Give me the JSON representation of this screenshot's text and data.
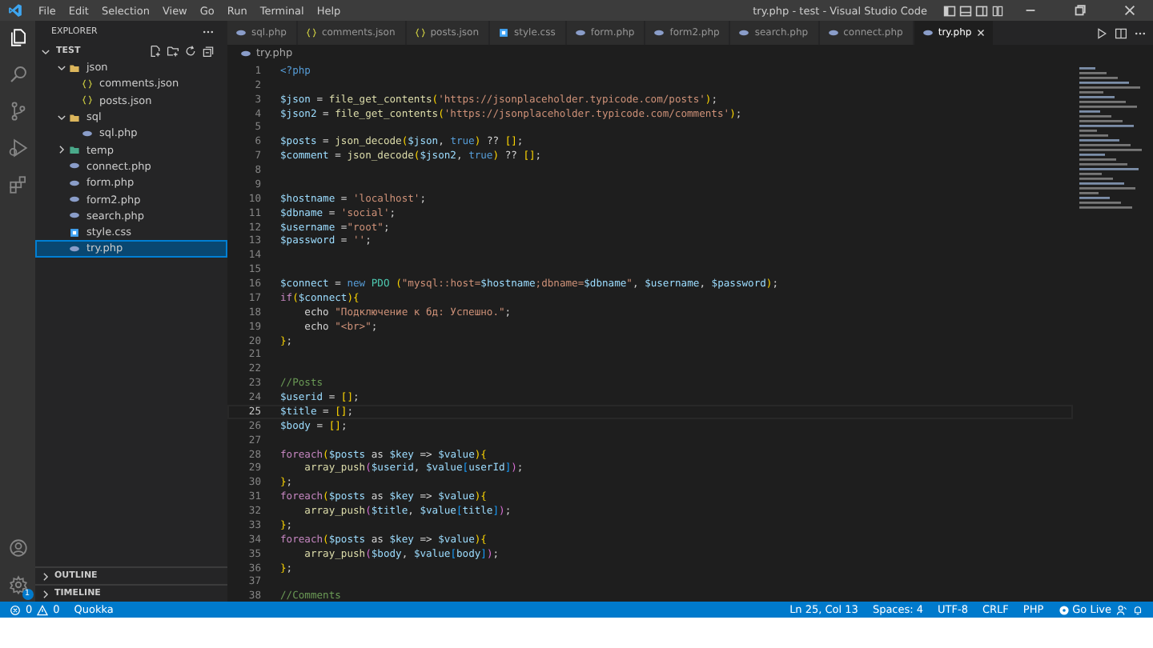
{
  "window": {
    "title": "try.php - test - Visual Studio Code"
  },
  "menu": [
    "File",
    "Edit",
    "Selection",
    "View",
    "Go",
    "Run",
    "Terminal",
    "Help"
  ],
  "activity_bar": {
    "badge": "1"
  },
  "explorer": {
    "title": "EXPLORER",
    "root": "TEST",
    "items": [
      {
        "label": "json",
        "kind": "folder",
        "expanded": true,
        "selected": false,
        "children": [
          {
            "label": "comments.json",
            "kind": "json",
            "selected": false
          },
          {
            "label": "posts.json",
            "kind": "json",
            "selected": false
          }
        ]
      },
      {
        "label": "sql",
        "kind": "folder",
        "expanded": true,
        "selected": false,
        "children": [
          {
            "label": "sql.php",
            "kind": "php",
            "selected": false
          }
        ]
      },
      {
        "label": "temp",
        "kind": "folder",
        "expanded": false,
        "selected": false
      },
      {
        "label": "connect.php",
        "kind": "php",
        "selected": false
      },
      {
        "label": "form.php",
        "kind": "php",
        "selected": false
      },
      {
        "label": "form2.php",
        "kind": "php",
        "selected": false
      },
      {
        "label": "search.php",
        "kind": "php",
        "selected": false
      },
      {
        "label": "style.css",
        "kind": "css",
        "selected": false
      },
      {
        "label": "try.php",
        "kind": "php",
        "selected": true
      }
    ],
    "sections": [
      "OUTLINE",
      "TIMELINE"
    ]
  },
  "tabs": [
    {
      "label": "sql.php",
      "kind": "php",
      "selected": false
    },
    {
      "label": "comments.json",
      "kind": "json",
      "selected": false
    },
    {
      "label": "posts.json",
      "kind": "json",
      "selected": false
    },
    {
      "label": "style.css",
      "kind": "css",
      "selected": false
    },
    {
      "label": "form.php",
      "kind": "php",
      "selected": false
    },
    {
      "label": "form2.php",
      "kind": "php",
      "selected": false
    },
    {
      "label": "search.php",
      "kind": "php",
      "selected": false
    },
    {
      "label": "connect.php",
      "kind": "php",
      "selected": false
    },
    {
      "label": "try.php",
      "kind": "php",
      "selected": true
    }
  ],
  "breadcrumb": "try.php",
  "code": [
    {
      "n": "1",
      "current": false,
      "t": [
        {
          "kind": "tag",
          "text": "<?php"
        }
      ]
    },
    {
      "n": "2",
      "current": false
    },
    {
      "n": "3",
      "current": false,
      "t": [
        {
          "kind": "var",
          "text": "$json"
        },
        {
          "kind": "op",
          "text": " = "
        },
        {
          "kind": "fn",
          "text": "file_get_contents"
        },
        {
          "kind": "b1",
          "text": "("
        },
        {
          "kind": "str",
          "text": "'https://jsonplaceholder.typicode.com/posts'"
        },
        {
          "kind": "b1",
          "text": ")"
        },
        {
          "kind": "op",
          "text": ";"
        }
      ]
    },
    {
      "n": "4",
      "current": false,
      "t": [
        {
          "kind": "var",
          "text": "$json2"
        },
        {
          "kind": "op",
          "text": " = "
        },
        {
          "kind": "fn",
          "text": "file_get_contents"
        },
        {
          "kind": "b1",
          "text": "("
        },
        {
          "kind": "str",
          "text": "'https://jsonplaceholder.typicode.com/comments'"
        },
        {
          "kind": "b1",
          "text": ")"
        },
        {
          "kind": "op",
          "text": ";"
        }
      ]
    },
    {
      "n": "5",
      "current": false
    },
    {
      "n": "6",
      "current": false,
      "t": [
        {
          "kind": "var",
          "text": "$posts"
        },
        {
          "kind": "op",
          "text": " = "
        },
        {
          "kind": "fn",
          "text": "json_decode"
        },
        {
          "kind": "b1",
          "text": "("
        },
        {
          "kind": "var",
          "text": "$json"
        },
        {
          "kind": "op",
          "text": ", "
        },
        {
          "kind": "const",
          "text": "true"
        },
        {
          "kind": "b1",
          "text": ")"
        },
        {
          "kind": "op",
          "text": " ?? "
        },
        {
          "kind": "b1",
          "text": "[]"
        },
        {
          "kind": "op",
          "text": ";"
        }
      ]
    },
    {
      "n": "7",
      "current": false,
      "t": [
        {
          "kind": "var",
          "text": "$comment"
        },
        {
          "kind": "op",
          "text": " = "
        },
        {
          "kind": "fn",
          "text": "json_decode"
        },
        {
          "kind": "b1",
          "text": "("
        },
        {
          "kind": "var",
          "text": "$json2"
        },
        {
          "kind": "op",
          "text": ", "
        },
        {
          "kind": "const",
          "text": "true"
        },
        {
          "kind": "b1",
          "text": ")"
        },
        {
          "kind": "op",
          "text": " ?? "
        },
        {
          "kind": "b1",
          "text": "[]"
        },
        {
          "kind": "op",
          "text": ";"
        }
      ]
    },
    {
      "n": "8",
      "current": false
    },
    {
      "n": "9",
      "current": false
    },
    {
      "n": "10",
      "current": false,
      "t": [
        {
          "kind": "var",
          "text": "$hostname"
        },
        {
          "kind": "op",
          "text": " = "
        },
        {
          "kind": "str",
          "text": "'localhost'"
        },
        {
          "kind": "op",
          "text": ";"
        }
      ]
    },
    {
      "n": "11",
      "current": false,
      "t": [
        {
          "kind": "var",
          "text": "$dbname"
        },
        {
          "kind": "op",
          "text": " = "
        },
        {
          "kind": "str",
          "text": "'social'"
        },
        {
          "kind": "op",
          "text": ";"
        }
      ]
    },
    {
      "n": "12",
      "current": false,
      "t": [
        {
          "kind": "var",
          "text": "$username"
        },
        {
          "kind": "op",
          "text": " ="
        },
        {
          "kind": "str",
          "text": "\"root\""
        },
        {
          "kind": "op",
          "text": ";"
        }
      ]
    },
    {
      "n": "13",
      "current": false,
      "t": [
        {
          "kind": "var",
          "text": "$password"
        },
        {
          "kind": "op",
          "text": " = "
        },
        {
          "kind": "str",
          "text": "''"
        },
        {
          "kind": "op",
          "text": ";"
        }
      ]
    },
    {
      "n": "14",
      "current": false
    },
    {
      "n": "15",
      "current": false
    },
    {
      "n": "16",
      "current": false,
      "t": [
        {
          "kind": "var",
          "text": "$connect"
        },
        {
          "kind": "op",
          "text": " = "
        },
        {
          "kind": "const",
          "text": "new"
        },
        {
          "kind": "cls",
          "text": " PDO "
        },
        {
          "kind": "b1",
          "text": "("
        },
        {
          "kind": "str",
          "text": "\"mysql::host="
        },
        {
          "kind": "var",
          "text": "$hostname"
        },
        {
          "kind": "str",
          "text": ";dbname="
        },
        {
          "kind": "var",
          "text": "$dbname"
        },
        {
          "kind": "str",
          "text": "\""
        },
        {
          "kind": "op",
          "text": ", "
        },
        {
          "kind": "var",
          "text": "$username"
        },
        {
          "kind": "op",
          "text": ", "
        },
        {
          "kind": "var",
          "text": "$password"
        },
        {
          "kind": "b1",
          "text": ")"
        },
        {
          "kind": "op",
          "text": ";"
        }
      ]
    },
    {
      "n": "17",
      "current": false,
      "t": [
        {
          "kind": "kw",
          "text": "if"
        },
        {
          "kind": "b1",
          "text": "("
        },
        {
          "kind": "var",
          "text": "$connect"
        },
        {
          "kind": "b1",
          "text": "){"
        }
      ]
    },
    {
      "n": "18",
      "current": false,
      "t": [
        {
          "kind": "op",
          "text": "    echo "
        },
        {
          "kind": "str",
          "text": "\"Подключение к бд: Успешно.\""
        },
        {
          "kind": "op",
          "text": ";"
        }
      ]
    },
    {
      "n": "19",
      "current": false,
      "t": [
        {
          "kind": "op",
          "text": "    echo "
        },
        {
          "kind": "str",
          "text": "\"<br>\""
        },
        {
          "kind": "op",
          "text": ";"
        }
      ]
    },
    {
      "n": "20",
      "current": false,
      "t": [
        {
          "kind": "b1",
          "text": "}"
        },
        {
          "kind": "op",
          "text": ";"
        }
      ]
    },
    {
      "n": "21",
      "current": false
    },
    {
      "n": "22",
      "current": false
    },
    {
      "n": "23",
      "current": false,
      "t": [
        {
          "kind": "comment",
          "text": "//Posts"
        }
      ]
    },
    {
      "n": "24",
      "current": false,
      "t": [
        {
          "kind": "var",
          "text": "$userid"
        },
        {
          "kind": "op",
          "text": " = "
        },
        {
          "kind": "b1",
          "text": "[]"
        },
        {
          "kind": "op",
          "text": ";"
        }
      ]
    },
    {
      "n": "25",
      "current": true,
      "t": [
        {
          "kind": "var",
          "text": "$title"
        },
        {
          "kind": "op",
          "text": " = "
        },
        {
          "kind": "b1",
          "text": "[]"
        },
        {
          "kind": "op",
          "text": ";"
        }
      ]
    },
    {
      "n": "26",
      "current": false,
      "t": [
        {
          "kind": "var",
          "text": "$body"
        },
        {
          "kind": "op",
          "text": " = "
        },
        {
          "kind": "b1",
          "text": "[]"
        },
        {
          "kind": "op",
          "text": ";"
        }
      ]
    },
    {
      "n": "27",
      "current": false
    },
    {
      "n": "28",
      "current": false,
      "t": [
        {
          "kind": "kw",
          "text": "foreach"
        },
        {
          "kind": "b1",
          "text": "("
        },
        {
          "kind": "var",
          "text": "$posts"
        },
        {
          "kind": "op",
          "text": " as "
        },
        {
          "kind": "var",
          "text": "$key"
        },
        {
          "kind": "op",
          "text": " => "
        },
        {
          "kind": "var",
          "text": "$value"
        },
        {
          "kind": "b1",
          "text": "){"
        }
      ]
    },
    {
      "n": "29",
      "current": false,
      "t": [
        {
          "kind": "fn",
          "text": "    array_push"
        },
        {
          "kind": "b2",
          "text": "("
        },
        {
          "kind": "var",
          "text": "$userid"
        },
        {
          "kind": "op",
          "text": ", "
        },
        {
          "kind": "var",
          "text": "$value"
        },
        {
          "kind": "b3",
          "text": "["
        },
        {
          "kind": "var",
          "text": "userId"
        },
        {
          "kind": "b3",
          "text": "]"
        },
        {
          "kind": "b2",
          "text": ")"
        },
        {
          "kind": "op",
          "text": ";"
        }
      ]
    },
    {
      "n": "30",
      "current": false,
      "t": [
        {
          "kind": "b1",
          "text": "}"
        },
        {
          "kind": "op",
          "text": ";"
        }
      ]
    },
    {
      "n": "31",
      "current": false,
      "t": [
        {
          "kind": "kw",
          "text": "foreach"
        },
        {
          "kind": "b1",
          "text": "("
        },
        {
          "kind": "var",
          "text": "$posts"
        },
        {
          "kind": "op",
          "text": " as "
        },
        {
          "kind": "var",
          "text": "$key"
        },
        {
          "kind": "op",
          "text": " => "
        },
        {
          "kind": "var",
          "text": "$value"
        },
        {
          "kind": "b1",
          "text": "){"
        }
      ]
    },
    {
      "n": "32",
      "current": false,
      "t": [
        {
          "kind": "fn",
          "text": "    array_push"
        },
        {
          "kind": "b2",
          "text": "("
        },
        {
          "kind": "var",
          "text": "$title"
        },
        {
          "kind": "op",
          "text": ", "
        },
        {
          "kind": "var",
          "text": "$value"
        },
        {
          "kind": "b3",
          "text": "["
        },
        {
          "kind": "var",
          "text": "title"
        },
        {
          "kind": "b3",
          "text": "]"
        },
        {
          "kind": "b2",
          "text": ")"
        },
        {
          "kind": "op",
          "text": ";"
        }
      ]
    },
    {
      "n": "33",
      "current": false,
      "t": [
        {
          "kind": "b1",
          "text": "}"
        },
        {
          "kind": "op",
          "text": ";"
        }
      ]
    },
    {
      "n": "34",
      "current": false,
      "t": [
        {
          "kind": "kw",
          "text": "foreach"
        },
        {
          "kind": "b1",
          "text": "("
        },
        {
          "kind": "var",
          "text": "$posts"
        },
        {
          "kind": "op",
          "text": " as "
        },
        {
          "kind": "var",
          "text": "$key"
        },
        {
          "kind": "op",
          "text": " => "
        },
        {
          "kind": "var",
          "text": "$value"
        },
        {
          "kind": "b1",
          "text": "){"
        }
      ]
    },
    {
      "n": "35",
      "current": false,
      "t": [
        {
          "kind": "fn",
          "text": "    array_push"
        },
        {
          "kind": "b2",
          "text": "("
        },
        {
          "kind": "var",
          "text": "$body"
        },
        {
          "kind": "op",
          "text": ", "
        },
        {
          "kind": "var",
          "text": "$value"
        },
        {
          "kind": "b3",
          "text": "["
        },
        {
          "kind": "var",
          "text": "body"
        },
        {
          "kind": "b3",
          "text": "]"
        },
        {
          "kind": "b2",
          "text": ")"
        },
        {
          "kind": "op",
          "text": ";"
        }
      ]
    },
    {
      "n": "36",
      "current": false,
      "t": [
        {
          "kind": "b1",
          "text": "}"
        },
        {
          "kind": "op",
          "text": ";"
        }
      ]
    },
    {
      "n": "37",
      "current": false
    },
    {
      "n": "38",
      "current": false,
      "t": [
        {
          "kind": "comment",
          "text": "//Comments"
        }
      ]
    }
  ],
  "status_bar": {
    "errors": "0",
    "warnings": "0",
    "left": [
      "Quokka"
    ],
    "right": [
      "Ln 25, Col 13",
      "Spaces: 4",
      "UTF-8",
      "CRLF",
      "PHP"
    ],
    "go_live": "Go Live"
  }
}
